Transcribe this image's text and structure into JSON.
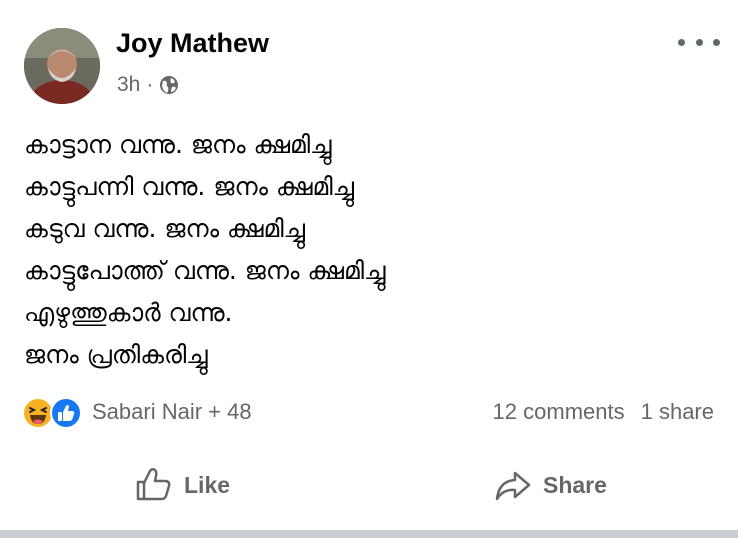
{
  "post": {
    "author": "Joy Mathew",
    "time": "3h",
    "separator": "·",
    "privacy_icon": "globe-icon",
    "more_icon": "more-options-icon",
    "lines": [
      "കാട്ടാന വന്നു.  ജനം ക്ഷമിച്ചു",
      "കാട്ടുപന്നി വന്നു.  ജനം ക്ഷമിച്ചു",
      "കടുവ വന്നു.  ജനം ക്ഷമിച്ചു",
      "കാട്ടുപോത്ത് വന്നു. ജനം ക്ഷമിച്ചു",
      "എഴുത്തുകാർ വന്നു.",
      "ജനം പ്രതികരിച്ചു"
    ],
    "reactions": {
      "icons": [
        "haha-icon",
        "like-reaction-icon"
      ],
      "summary": "Sabari Nair + 48"
    },
    "comments": "12 comments",
    "shares": "1 share",
    "actions": {
      "like": "Like",
      "share": "Share"
    }
  },
  "colors": {
    "text": "#050505",
    "secondary_text": "#65676b",
    "like_blue": "#1877f2",
    "haha_yellow": "#f7b125",
    "divider": "#c9ccd1"
  }
}
